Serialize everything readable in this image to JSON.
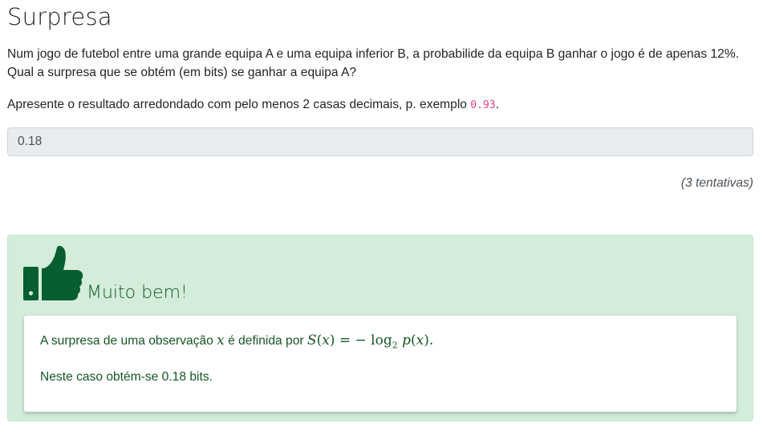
{
  "page": {
    "title": "Surpresa",
    "question": "Num jogo de futebol entre uma grande equipa A e uma equipa inferior B, a probabilide da equipa B ganhar o jogo é de apenas 12%. Qual a surpresa que se obtém (em bits) se ganhar a equipa A?",
    "instruction_prefix": "Apresente o resultado arredondado com pelo menos 2 casas decimais, p. exemplo ",
    "instruction_example": "0.93",
    "instruction_suffix": "."
  },
  "answer": {
    "value": "0.18"
  },
  "attempts": "(3 tentativas)",
  "feedback": {
    "icon": "thumbs-up-icon",
    "verdict": "Muito bem!",
    "explanation_prefix": "A surpresa de uma observação ",
    "explanation_var": "x",
    "explanation_middle": " é definida por ",
    "formula_lhs": "S",
    "formula_arg": "x",
    "formula_eq": "= − log",
    "formula_base": "2",
    "formula_p": "p",
    "formula_end": ".",
    "result": "Neste caso obtém-se 0.18 bits.",
    "colors": {
      "success_bg": "#d4edda",
      "success_text": "#155724",
      "icon": "#075e2e"
    }
  }
}
